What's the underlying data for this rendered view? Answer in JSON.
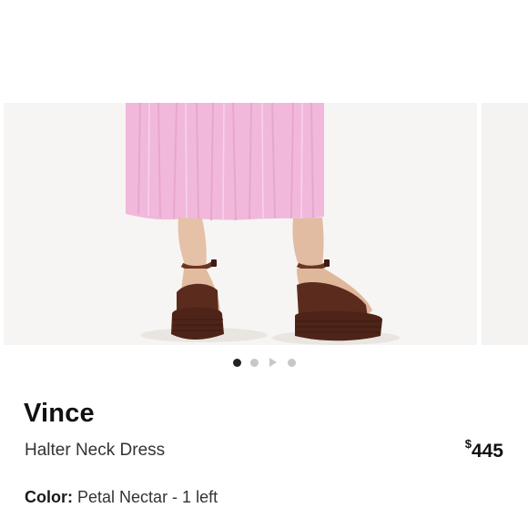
{
  "listing": {
    "brand": "Vince",
    "title": "Halter Neck Dress",
    "price_symbol": "$",
    "price_amount": "445",
    "color_label": "Color:",
    "color_value": "Petal Nectar - 1 left"
  },
  "carousel": {
    "total_items": 4,
    "active_index": 0,
    "item_types": [
      "image",
      "image",
      "video",
      "image"
    ]
  },
  "colors": {
    "dress": "#f0b7dc",
    "sandal": "#5b2c1e",
    "active_dot": "#222222",
    "inactive_dot": "#c7c7c7"
  }
}
